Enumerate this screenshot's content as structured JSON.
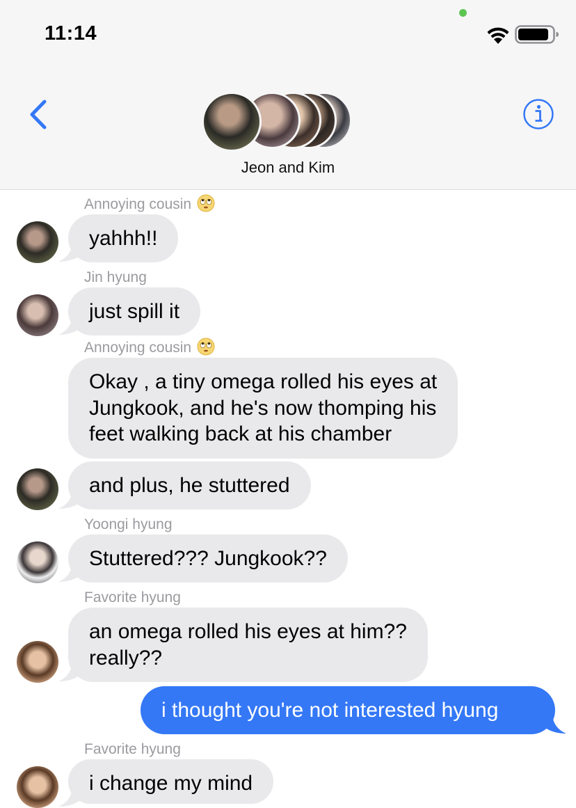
{
  "status_bar": {
    "time": "11:14"
  },
  "header": {
    "group_name": "Jeon and Kim"
  },
  "colors": {
    "incoming_bubble": "#e9e9eb",
    "outgoing_bubble": "#3478f6",
    "accent": "#3478f6",
    "sender_name": "#9b9ba0"
  },
  "messages": [
    {
      "sender": "Annoying cousin",
      "sender_emoji": "face-with-rolling-eyes-emoji",
      "text": "yahhh!!"
    },
    {
      "sender": "Jin hyung",
      "text": "just spill it"
    },
    {
      "sender": "Annoying cousin",
      "sender_emoji": "face-with-rolling-eyes-emoji",
      "lines": [
        "Okay , a tiny omega rolled his eyes at",
        "Jungkook, and he's now thomping his",
        "feet walking back at his chamber"
      ]
    },
    {
      "text": "and plus, he stuttered"
    },
    {
      "sender": "Yoongi hyung",
      "text": "Stuttered??? Jungkook??"
    },
    {
      "sender": "Favorite hyung",
      "lines": [
        "an omega rolled his eyes at him??",
        "really??"
      ]
    },
    {
      "outgoing": true,
      "text": "i thought you're not interested hyung"
    },
    {
      "sender": "Favorite hyung",
      "text": "i change my mind"
    }
  ]
}
